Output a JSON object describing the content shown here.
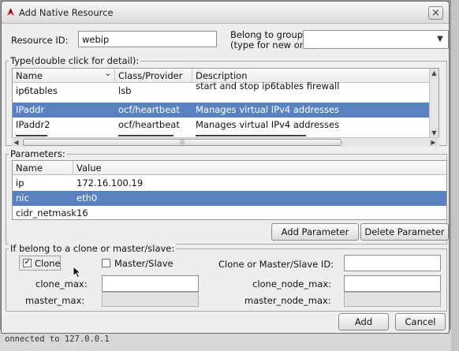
{
  "window": {
    "title": "Add Native Resource",
    "close_glyph": "×"
  },
  "resource": {
    "id_label": "Resource ID:",
    "id_value": "webip",
    "group_label_line1": "Belong to group:",
    "group_label_line2": "(type for new one)",
    "group_value": ""
  },
  "types": {
    "title": "Type(double click for detail):",
    "columns": [
      "Name",
      "Class/Provider",
      "Description"
    ],
    "rows": [
      {
        "name": "ip6tables",
        "provider": "lsb",
        "description": "start and stop ip6tables firewall"
      },
      {
        "name": "IPaddr",
        "provider": "ocf/heartbeat",
        "description": "Manages virtual IPv4 addresses"
      },
      {
        "name": "IPaddr2",
        "provider": "ocf/heartbeat",
        "description": "Manages virtual IPv4 addresses"
      }
    ],
    "selected_index": 1
  },
  "parameters": {
    "title": "Parameters:",
    "columns": [
      "Name",
      "Value"
    ],
    "rows": [
      {
        "name": "ip",
        "value": "172.16.100.19"
      },
      {
        "name": "nic",
        "value": "eth0"
      },
      {
        "name": "cidr_netmask",
        "value": "16"
      }
    ],
    "selected_index": 1,
    "add_label": "Add Parameter",
    "delete_label": "Delete Parameter"
  },
  "clone": {
    "title": "If belong to a clone or master/slave:",
    "clone_label": "Clone",
    "clone_checked": true,
    "master_slave_label": "Master/Slave",
    "master_slave_checked": false,
    "id_label": "Clone or Master/Slave ID:",
    "clone_max_label": "clone_max:",
    "clone_node_max_label": "clone_node_max:",
    "master_max_label": "master_max:",
    "master_node_max_label": "master_node_max:"
  },
  "actions": {
    "add_label": "Add",
    "cancel_label": "Cancel"
  },
  "background": {
    "terminal_text": "onnected to 127.0.0.1"
  },
  "colors": {
    "selection": "#5b82c0",
    "accent_icon": "#c0202a"
  }
}
